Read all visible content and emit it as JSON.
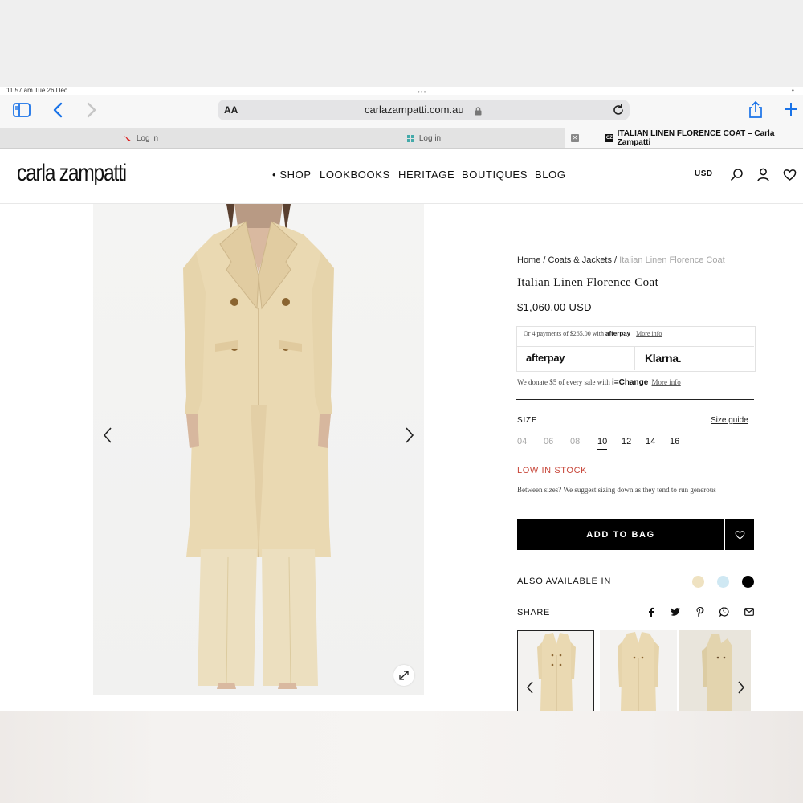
{
  "status": {
    "time": "11:57 am   Tue 26 Dec",
    "dots": "•••",
    "right": "•"
  },
  "browser": {
    "address_size_label": "AA",
    "url": "carlazampatti.com.au",
    "tabs": [
      {
        "label": "Log in"
      },
      {
        "label": "Log in"
      },
      {
        "label": "ITALIAN LINEN FLORENCE COAT – Carla Zampatti",
        "favicon": "CZ"
      }
    ]
  },
  "site": {
    "logo": "carla zampatti",
    "nav": [
      "• SHOP",
      "LOOKBOOKS",
      "HERITAGE",
      "BOUTIQUES",
      "BLOG"
    ],
    "currency": "USD"
  },
  "product": {
    "breadcrumb": {
      "home": "Home",
      "sep": " / ",
      "category": "Coats & Jackets",
      "current": "Italian Linen Florence Coat"
    },
    "title": "Italian Linen Florence Coat",
    "price": "$1,060.00 USD",
    "installments": {
      "text": "Or 4 payments of $265.00 with",
      "brand": "afterpay",
      "link": "More info"
    },
    "pay_options": [
      "afterpay",
      "Klarna."
    ],
    "donate": {
      "text": "We donate $5 of every sale with",
      "brand": "i=Change",
      "link": "More info"
    },
    "size_label": "SIZE",
    "size_guide": "Size guide",
    "sizes": [
      {
        "label": "04",
        "available": false
      },
      {
        "label": "06",
        "available": false
      },
      {
        "label": "08",
        "available": false
      },
      {
        "label": "10",
        "available": true,
        "selected": true
      },
      {
        "label": "12",
        "available": true
      },
      {
        "label": "14",
        "available": true
      },
      {
        "label": "16",
        "available": true
      }
    ],
    "stock_status": "LOW IN STOCK",
    "sizing_note": "Between sizes? We suggest sizing down as they tend to run generous",
    "add_to_bag": "ADD TO BAG",
    "also_available_label": "ALSO AVAILABLE IN",
    "swatches": [
      "#efe2c1",
      "#cfe8f3",
      "#000000"
    ],
    "share_label": "SHARE",
    "share_icons": [
      "facebook-icon",
      "twitter-icon",
      "pinterest-icon",
      "whatsapp-icon",
      "email-icon"
    ]
  },
  "colors": {
    "accent_low_stock": "#c8473a",
    "safari_blue": "#1a73e8",
    "coat": "#ead9b2"
  }
}
